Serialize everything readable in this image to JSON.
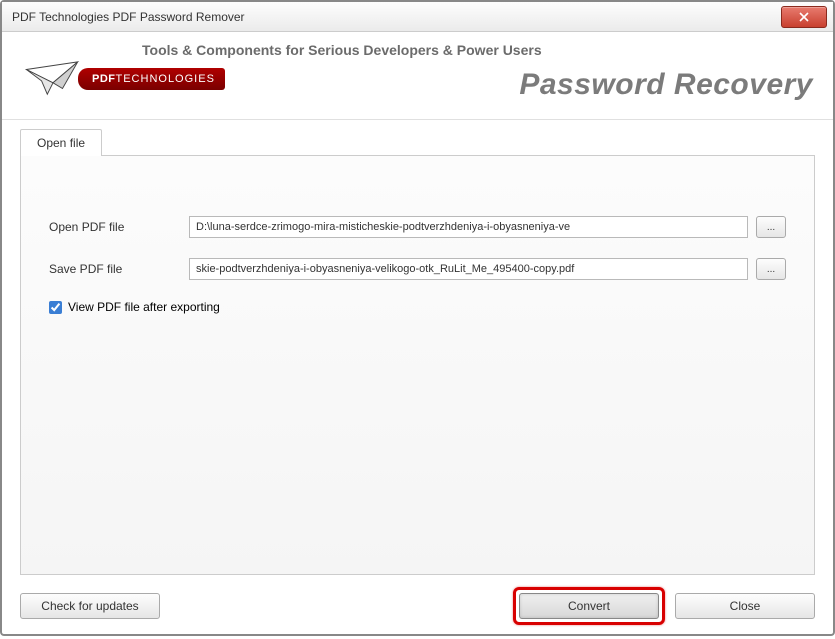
{
  "window": {
    "title": "PDF Technologies PDF Password Remover"
  },
  "header": {
    "tagline": "Tools & Components for Serious Developers & Power Users",
    "logo_prefix": "PDF",
    "logo_suffix": "TECHNOLOGIES",
    "product_title": "Password Recovery"
  },
  "tabs": {
    "open_file": "Open file"
  },
  "form": {
    "open_label": "Open PDF file",
    "open_value": "D:\\luna-serdce-zrimogo-mira-misticheskie-podtverzhdeniya-i-obyasneniya-ve",
    "save_label": "Save PDF file",
    "save_value": "skie-podtverzhdeniya-i-obyasneniya-velikogo-otk_RuLit_Me_495400-copy.pdf",
    "browse": "...",
    "view_after": "View PDF file after exporting",
    "view_after_checked": true
  },
  "footer": {
    "check_updates": "Check for updates",
    "convert": "Convert",
    "close": "Close"
  }
}
